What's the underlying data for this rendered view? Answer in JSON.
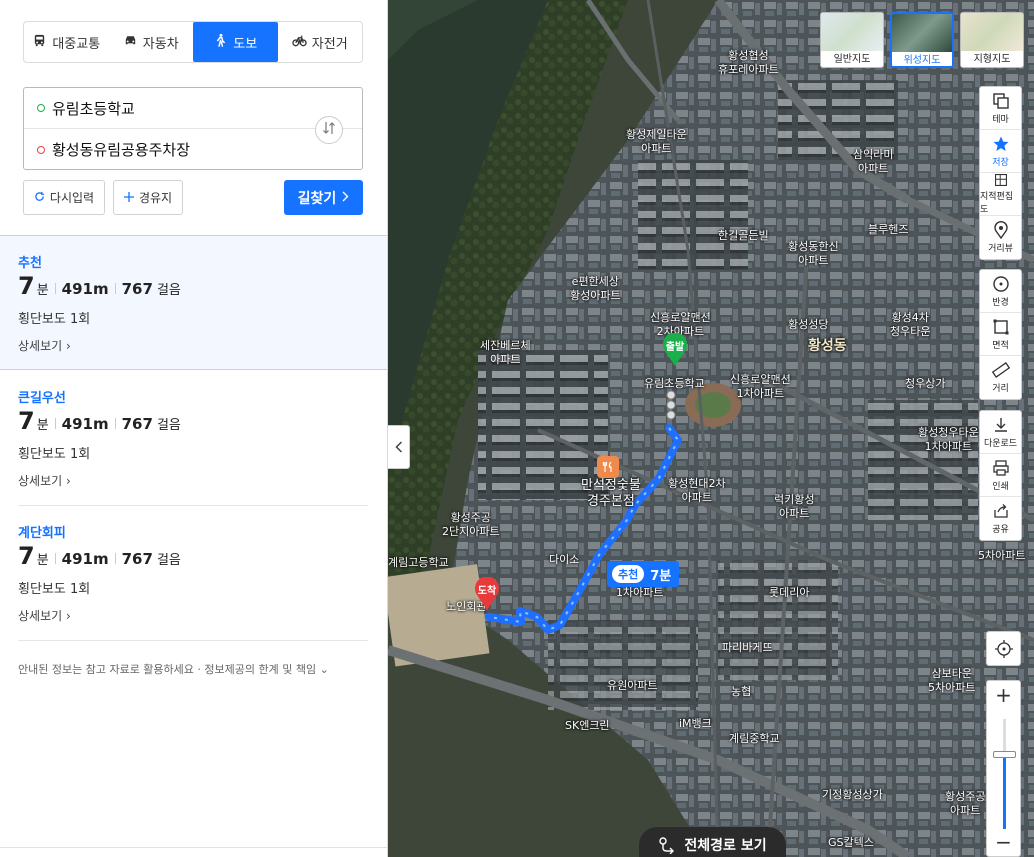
{
  "modes": [
    {
      "label": "대중교통",
      "icon": "bus-icon",
      "active": false
    },
    {
      "label": "자동차",
      "icon": "car-icon",
      "active": false
    },
    {
      "label": "도보",
      "icon": "walk-icon",
      "active": true
    },
    {
      "label": "자전거",
      "icon": "bicycle-icon",
      "active": false
    }
  ],
  "route": {
    "origin": "유림초등학교",
    "destination": "황성동유림공용주차장"
  },
  "buttons": {
    "reset": "다시입력",
    "via": "경유지",
    "search": "길찾기"
  },
  "results": [
    {
      "title": "추천",
      "minutes": "7",
      "minutes_unit": "분",
      "distance": "491m",
      "steps": "767",
      "steps_unit": "걸음",
      "crossings": "횡단보도 1회",
      "detail": "상세보기"
    },
    {
      "title": "큰길우선",
      "minutes": "7",
      "minutes_unit": "분",
      "distance": "491m",
      "steps": "767",
      "steps_unit": "걸음",
      "crossings": "횡단보도 1회",
      "detail": "상세보기"
    },
    {
      "title": "계단회피",
      "minutes": "7",
      "minutes_unit": "분",
      "distance": "491m",
      "steps": "767",
      "steps_unit": "걸음",
      "crossings": "횡단보도 1회",
      "detail": "상세보기"
    }
  ],
  "disclaimer": "안내된 정보는 참고 자료로 활용하세요 · 정보제공의 한계 및 책임",
  "map_types": [
    {
      "label": "일반지도",
      "active": false
    },
    {
      "label": "위성지도",
      "active": true
    },
    {
      "label": "지형지도",
      "active": false
    }
  ],
  "tools_group1": [
    {
      "label": "테마",
      "icon": "layers-icon"
    },
    {
      "label": "저장",
      "icon": "star-icon"
    },
    {
      "label": "지적편집도",
      "icon": "cadastral-icon"
    },
    {
      "label": "거리뷰",
      "icon": "roadview-pin-icon"
    }
  ],
  "tools_group2": [
    {
      "label": "반경",
      "icon": "radius-icon"
    },
    {
      "label": "면적",
      "icon": "area-icon"
    },
    {
      "label": "거리",
      "icon": "ruler-icon"
    }
  ],
  "tools_group3": [
    {
      "label": "다운로드",
      "icon": "download-icon"
    },
    {
      "label": "인쇄",
      "icon": "print-icon"
    },
    {
      "label": "공유",
      "icon": "share-icon"
    }
  ],
  "zoom": {
    "plus": "+",
    "minus": "−"
  },
  "route_badge": {
    "tag": "추천",
    "time": "7분"
  },
  "markers": {
    "start": "출발",
    "end": "도착"
  },
  "full_route": "전체경로 보기",
  "map_labels": [
    {
      "text": "황성협성\n휴포레아파트"
    },
    {
      "text": "황성제일타운\n아파트"
    },
    {
      "text": "삼익라미\n아파트"
    },
    {
      "text": "한길골든빌"
    },
    {
      "text": "황성동한신\n아파트"
    },
    {
      "text": "블루헨즈"
    },
    {
      "text": "e편한세상\n황성아파트"
    },
    {
      "text": "신흥로얄맨션\n2차아파트"
    },
    {
      "text": "황성성당"
    },
    {
      "text": "황성4차\n청우타운"
    },
    {
      "text": "세잔베르체\n아파트"
    },
    {
      "text": "황성동"
    },
    {
      "text": "유림초등학교"
    },
    {
      "text": "신흥로얄맨션\n1차아파트"
    },
    {
      "text": "청우상가"
    },
    {
      "text": "황성청우타운\n1차아파트"
    },
    {
      "text": "만석정숯불\n경주본점"
    },
    {
      "text": "황성현대2차\n아파트"
    },
    {
      "text": "럭키황성\n아파트"
    },
    {
      "text": "황성주공\n2단지아파트"
    },
    {
      "text": "다이소"
    },
    {
      "text": "계림고등학교"
    },
    {
      "text": "1차아파트"
    },
    {
      "text": "롯데리아"
    },
    {
      "text": "노인회관"
    },
    {
      "text": "파리바게뜨"
    },
    {
      "text": "삼보타운\n5차아파트"
    },
    {
      "text": "농협"
    },
    {
      "text": "유원아파트"
    },
    {
      "text": "SK엔크린"
    },
    {
      "text": "iM뱅크"
    },
    {
      "text": "계림중학교"
    },
    {
      "text": "기정황성상가"
    },
    {
      "text": "황성주공\n아파트"
    },
    {
      "text": "GS칼텍스"
    },
    {
      "text": "5차아파트"
    }
  ]
}
